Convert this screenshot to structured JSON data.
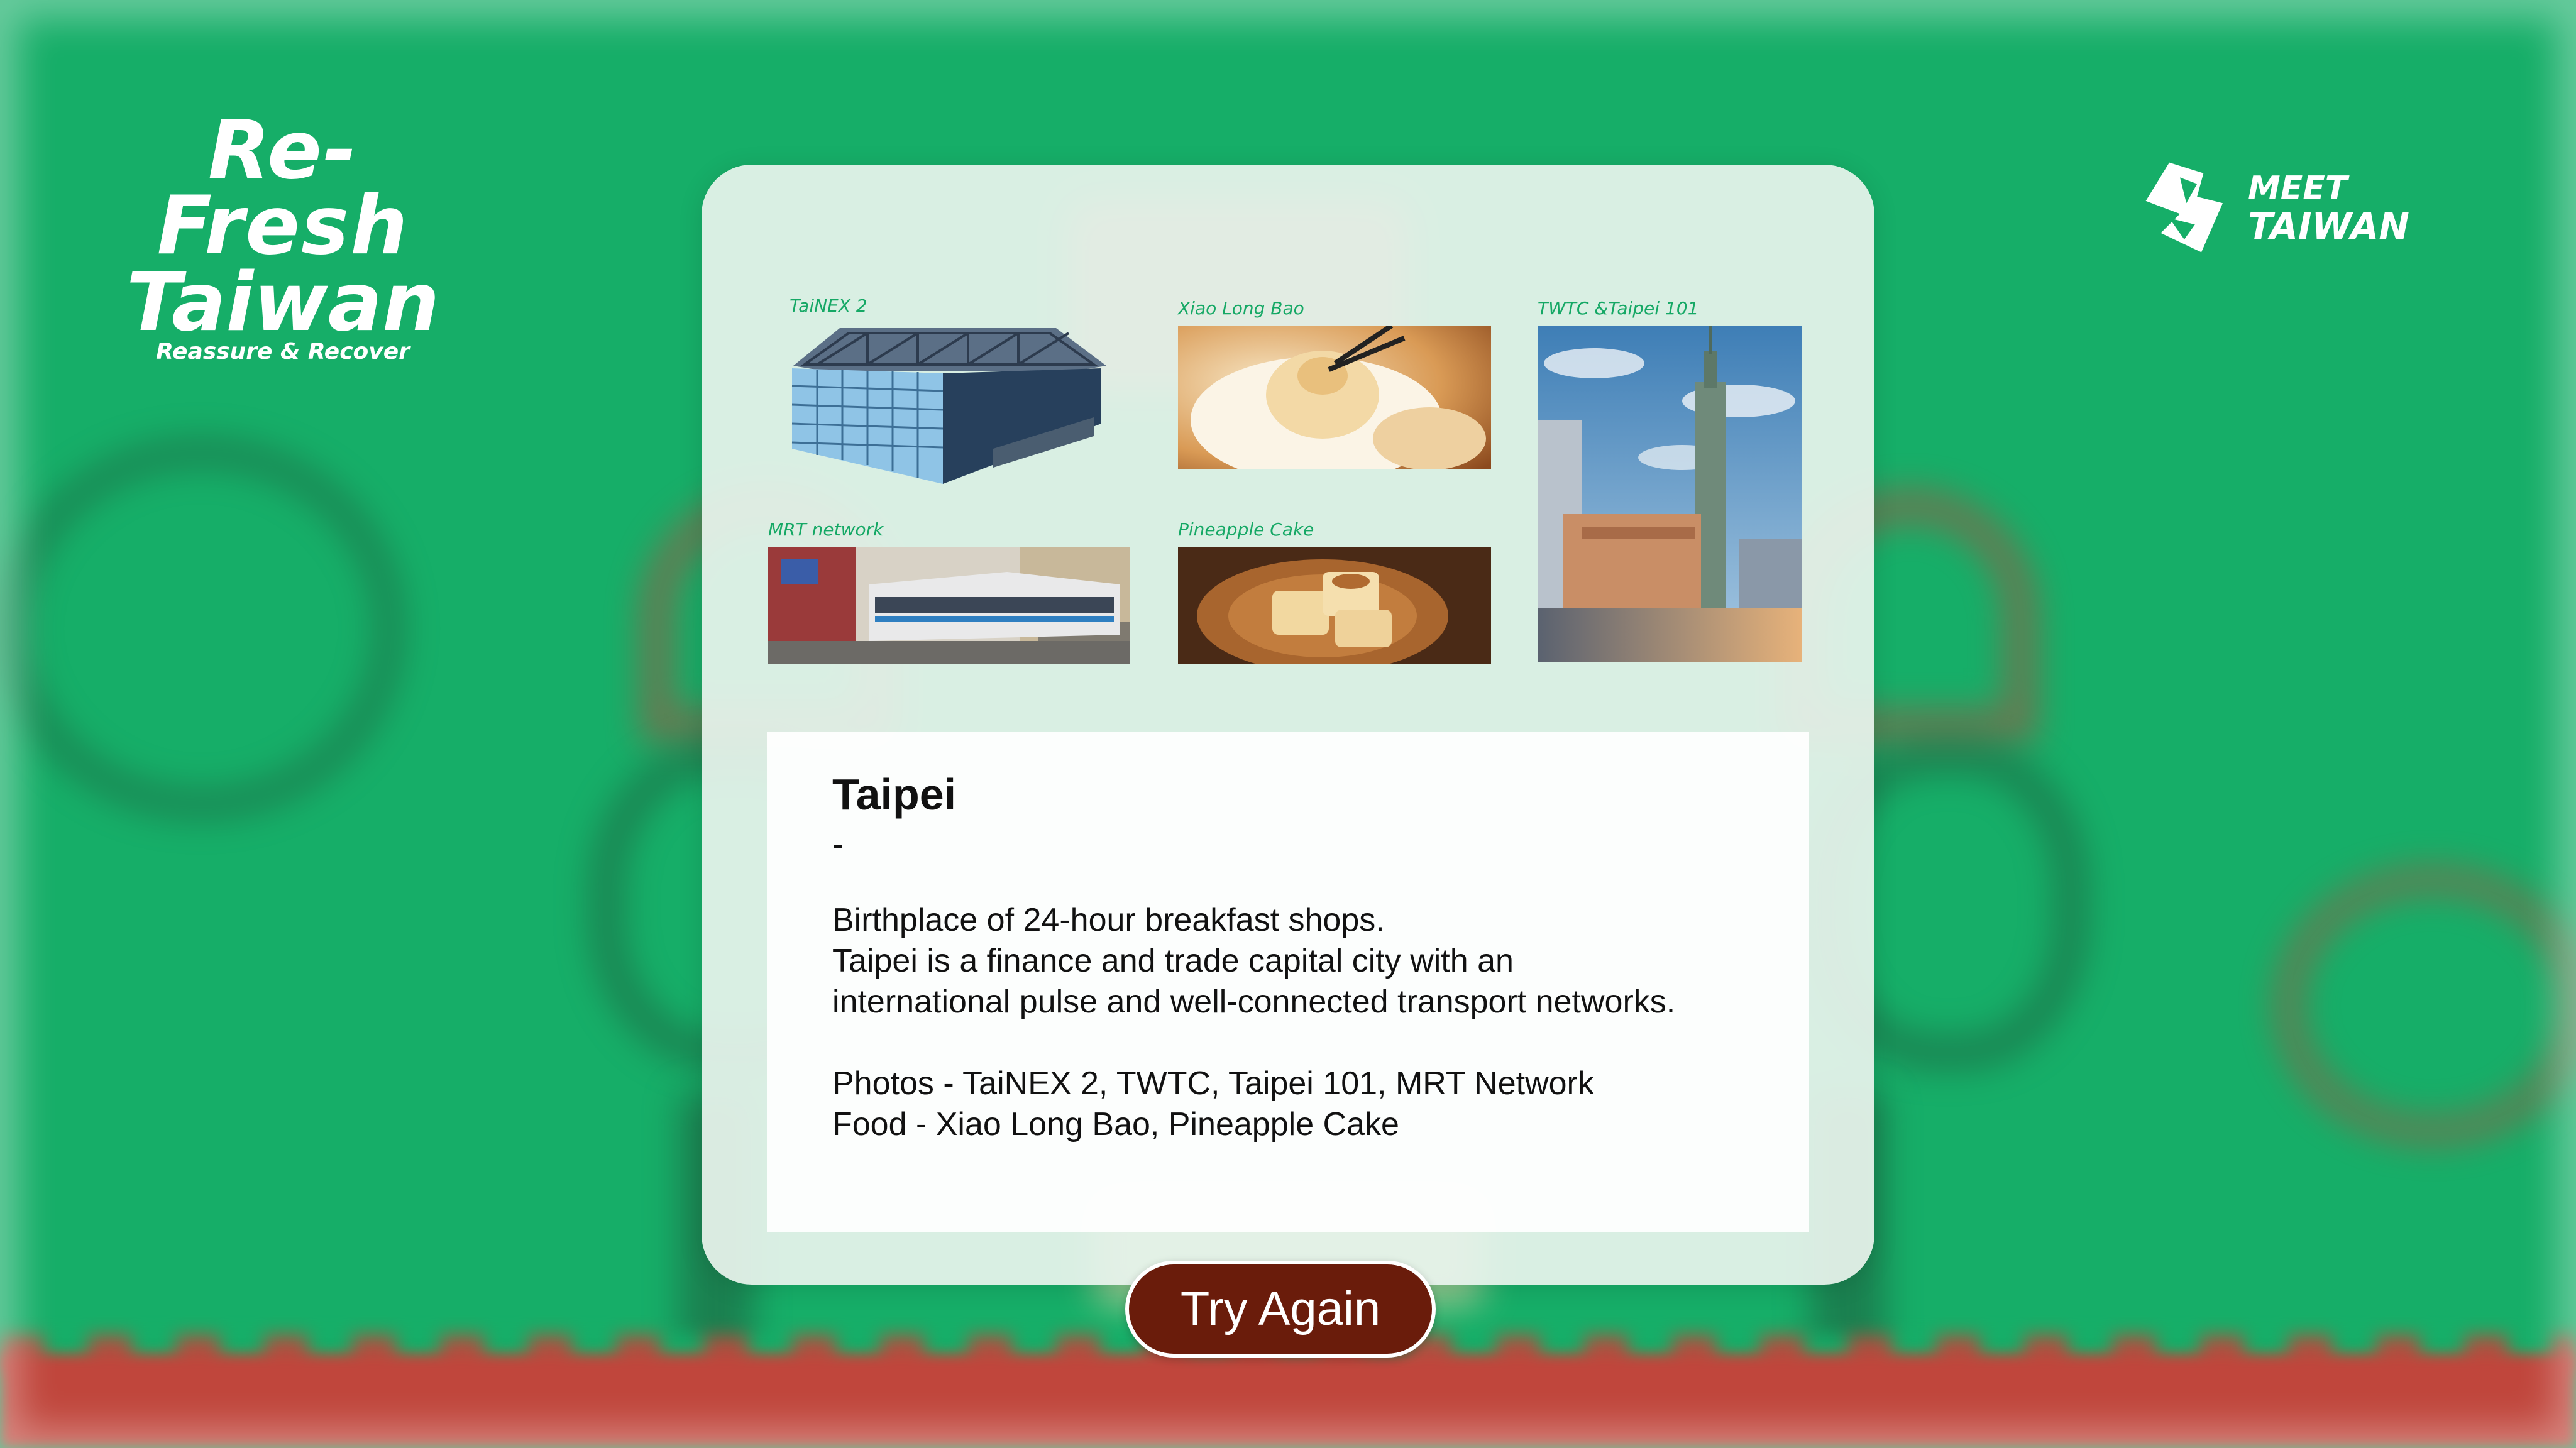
{
  "brand": {
    "line1": "Re-Fresh",
    "line2": "Taiwan",
    "tagline": "Reassure & Recover"
  },
  "partner_logo": {
    "line1": "MEET",
    "line2": "TAIWAN",
    "icon": "meet-taiwan-logo-icon"
  },
  "gallery": [
    {
      "caption": "TaiNEX 2",
      "image": "convention-hall-illustration"
    },
    {
      "caption": "Xiao Long Bao",
      "image": "soup-dumpling-photo"
    },
    {
      "caption": "TWTC &Taipei 101",
      "image": "taipei-101-skyline-photo"
    },
    {
      "caption": "MRT network",
      "image": "metro-train-photo"
    },
    {
      "caption": "Pineapple Cake",
      "image": "pineapple-cake-photo"
    }
  ],
  "info": {
    "title": "Taipei",
    "dash": "-",
    "description": [
      "Birthplace of 24-hour breakfast shops.",
      "Taipei is a finance and trade capital city with an",
      "international pulse and well-connected transport networks."
    ],
    "credits": [
      "Photos - TaiNEX 2, TWTC, Taipei 101, MRT Network",
      "Food - Xiao Long Bao, Pineapple Cake"
    ]
  },
  "try_again": {
    "label": "Try Again"
  },
  "colors": {
    "background": "#16ae68",
    "caption": "#15a865",
    "button": "#6a1c0b",
    "floor": "#c0463c"
  }
}
